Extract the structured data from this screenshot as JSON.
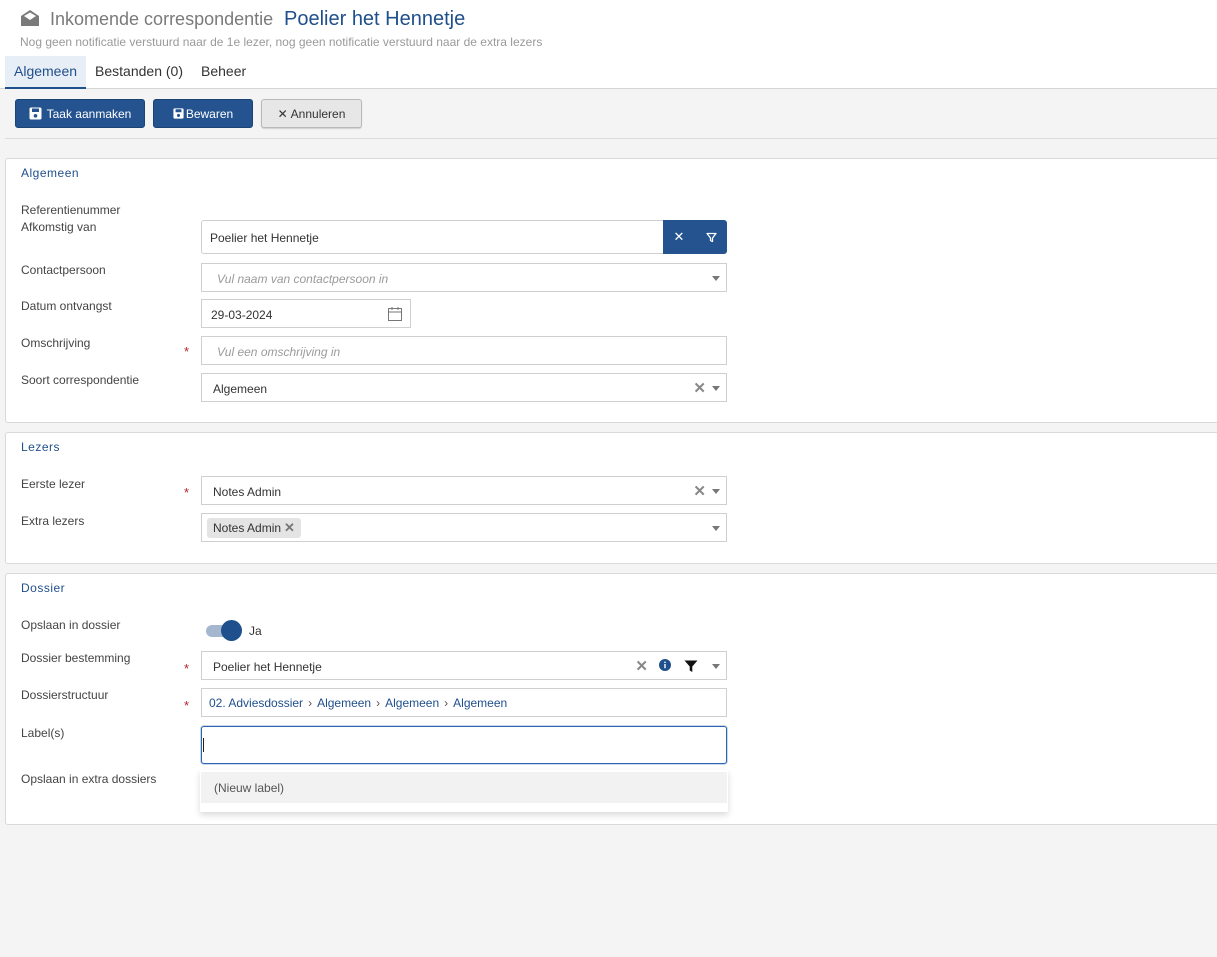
{
  "header": {
    "title_prefix": "Inkomende correspondentie",
    "title_main": "Poelier het Hennetje",
    "subtitle": "Nog geen notificatie verstuurd naar de 1e lezer, nog geen notificatie verstuurd naar de extra lezers",
    "icon": "envelope-open-icon",
    "tabs": [
      {
        "label": "Algemeen",
        "active": true
      },
      {
        "label": "Bestanden (0)",
        "active": false
      },
      {
        "label": "Beheer",
        "active": false
      }
    ]
  },
  "toolbar": {
    "task_label": "Taak aanmaken",
    "save_label": "Bewaren",
    "cancel_label": "Annuleren"
  },
  "algemeen": {
    "title": "Algemeen",
    "ref_label": "Referentienummer",
    "from_label": "Afkomstig van",
    "from_value": "Poelier het Hennetje",
    "contact_label": "Contactpersoon",
    "contact_placeholder": "Vul naam van contactpersoon in",
    "date_label": "Datum ontvangst",
    "date_value": "29-03-2024",
    "desc_label": "Omschrijving",
    "desc_placeholder": "Vul een omschrijving in",
    "type_label": "Soort correspondentie",
    "type_value": "Algemeen"
  },
  "lezers": {
    "title": "Lezers",
    "first_label": "Eerste lezer",
    "first_value": "Notes Admin",
    "extra_label": "Extra lezers",
    "extra_chip": "Notes Admin"
  },
  "dossier": {
    "title": "Dossier",
    "save_label": "Opslaan in dossier",
    "save_value": "Ja",
    "save_on": true,
    "dest_label": "Dossier bestemming",
    "dest_value": "Poelier het Hennetje",
    "structure_label": "Dossierstructuur",
    "structure_path": [
      "02. Adviesdossier",
      "Algemeen",
      "Algemeen",
      "Algemeen"
    ],
    "labels_label": "Label(s)",
    "labels_value": "",
    "extra_label": "Opslaan in extra dossiers",
    "dropdown_option": "(Nieuw label)"
  },
  "colors": {
    "primary": "#24538f",
    "required": "#b8202f",
    "title": "#1f4f8c"
  }
}
